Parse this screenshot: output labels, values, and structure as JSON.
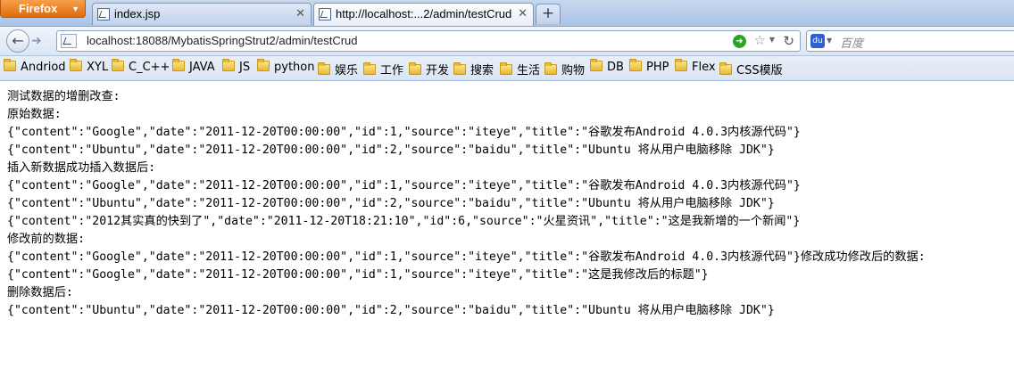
{
  "browser": {
    "app_button": "Firefox",
    "tabs": [
      {
        "label": "index.jsp"
      },
      {
        "label": "http://localhost:...2/admin/testCrud"
      }
    ],
    "new_tab_label": "+",
    "url": "localhost:18088/MybatisSpringStrut2/admin/testCrud",
    "search_placeholder": "百度",
    "bookmarks": [
      "Andriod",
      "XYL",
      "C_C++",
      "JAVA",
      "JS",
      "python",
      "娱乐",
      "工作",
      "开发",
      "搜索",
      "生活",
      "购物",
      "DB",
      "PHP",
      "Flex",
      "CSS模版"
    ]
  },
  "page": {
    "lines": [
      "测试数据的增删改查:",
      "原始数据:",
      "{\"content\":\"Google\",\"date\":\"2011-12-20T00:00:00\",\"id\":1,\"source\":\"iteye\",\"title\":\"谷歌发布Android 4.0.3内核源代码\"}",
      "{\"content\":\"Ubuntu\",\"date\":\"2011-12-20T00:00:00\",\"id\":2,\"source\":\"baidu\",\"title\":\"Ubuntu 将从用户电脑移除 JDK\"}",
      "插入新数据成功插入数据后:",
      "{\"content\":\"Google\",\"date\":\"2011-12-20T00:00:00\",\"id\":1,\"source\":\"iteye\",\"title\":\"谷歌发布Android 4.0.3内核源代码\"}",
      "{\"content\":\"Ubuntu\",\"date\":\"2011-12-20T00:00:00\",\"id\":2,\"source\":\"baidu\",\"title\":\"Ubuntu 将从用户电脑移除 JDK\"}",
      "{\"content\":\"2012其实真的快到了\",\"date\":\"2011-12-20T18:21:10\",\"id\":6,\"source\":\"火星资讯\",\"title\":\"这是我新增的一个新闻\"}",
      "修改前的数据:",
      "{\"content\":\"Google\",\"date\":\"2011-12-20T00:00:00\",\"id\":1,\"source\":\"iteye\",\"title\":\"谷歌发布Android 4.0.3内核源代码\"}修改成功修改后的数据:",
      "{\"content\":\"Google\",\"date\":\"2011-12-20T00:00:00\",\"id\":1,\"source\":\"iteye\",\"title\":\"这是我修改后的标题\"}",
      "删除数据后:",
      "{\"content\":\"Ubuntu\",\"date\":\"2011-12-20T00:00:00\",\"id\":2,\"source\":\"baidu\",\"title\":\"Ubuntu 将从用户电脑移除 JDK\"}"
    ]
  }
}
